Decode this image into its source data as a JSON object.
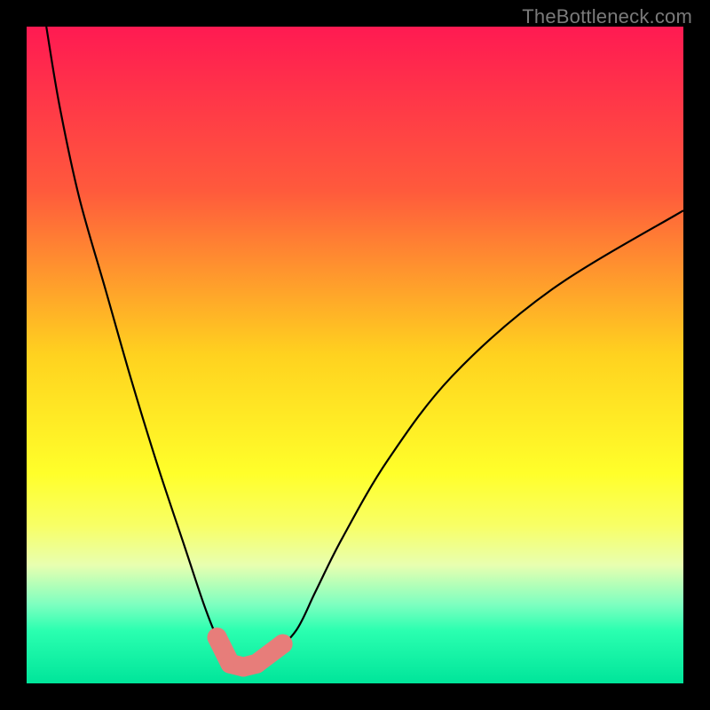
{
  "watermark": "TheBottleneck.com",
  "chart_data": {
    "type": "line",
    "title": "",
    "xlabel": "",
    "ylabel": "",
    "xlim": [
      0,
      100
    ],
    "ylim": [
      0,
      100
    ],
    "background_gradient": {
      "stops": [
        {
          "offset": 0,
          "color": "#ff1a52"
        },
        {
          "offset": 0.25,
          "color": "#ff5a3c"
        },
        {
          "offset": 0.5,
          "color": "#ffd21f"
        },
        {
          "offset": 0.68,
          "color": "#ffff2a"
        },
        {
          "offset": 0.76,
          "color": "#f8ff66"
        },
        {
          "offset": 0.82,
          "color": "#e8ffb0"
        },
        {
          "offset": 0.88,
          "color": "#7dffc0"
        },
        {
          "offset": 0.92,
          "color": "#2affb0"
        },
        {
          "offset": 1.0,
          "color": "#00e59a"
        }
      ]
    },
    "series": [
      {
        "name": "bottleneck-curve",
        "color": "#000000",
        "x": [
          3,
          5,
          8,
          12,
          16,
          20,
          24,
          27,
          29,
          31,
          33,
          35,
          37,
          41,
          44,
          48,
          55,
          65,
          80,
          100
        ],
        "y": [
          100,
          88,
          74,
          60,
          46,
          33,
          21,
          12,
          7,
          4,
          2.5,
          2.5,
          4,
          8,
          14,
          22,
          34,
          47,
          60,
          72
        ]
      }
    ],
    "annotations": [
      {
        "name": "valley-marker-left",
        "x": 29,
        "y": 7,
        "color": "#e77d7a"
      },
      {
        "name": "valley-marker-bottom1",
        "x": 31,
        "y": 3,
        "color": "#e77d7a"
      },
      {
        "name": "valley-marker-bottom2",
        "x": 33,
        "y": 2.5,
        "color": "#e77d7a"
      },
      {
        "name": "valley-marker-bottom3",
        "x": 35,
        "y": 3,
        "color": "#e77d7a"
      },
      {
        "name": "valley-marker-right",
        "x": 39,
        "y": 6,
        "color": "#e77d7a"
      }
    ]
  }
}
